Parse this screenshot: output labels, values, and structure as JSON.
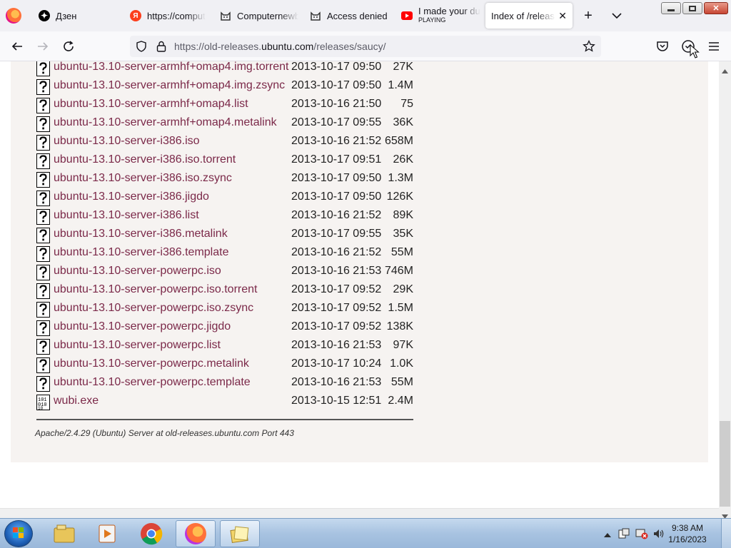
{
  "browser": {
    "tabs": [
      {
        "label": "Дзен",
        "icon": "dzen-icon"
      },
      {
        "label": "https://comput",
        "icon": "yandex-icon"
      },
      {
        "label": "Computernewb",
        "icon": "cat-icon"
      },
      {
        "label": "Access denied",
        "icon": "cat-icon"
      },
      {
        "label": "I made your du",
        "sublabel": "PLAYING",
        "icon": "youtube-icon"
      },
      {
        "label": "Index of /release",
        "icon": "none",
        "active": true
      }
    ],
    "url": {
      "prefix": "https://old-releases.",
      "host": "ubuntu.com",
      "path": "/releases/saucy/"
    }
  },
  "listing": {
    "rows": [
      {
        "name": "ubuntu-13.10-server-armhf+omap4.img.torrent",
        "date": "2013-10-17 09:50",
        "size": "27K",
        "icon": "unknown-file-icon"
      },
      {
        "name": "ubuntu-13.10-server-armhf+omap4.img.zsync",
        "date": "2013-10-17 09:50",
        "size": "1.4M",
        "icon": "unknown-file-icon"
      },
      {
        "name": "ubuntu-13.10-server-armhf+omap4.list",
        "date": "2013-10-16 21:50",
        "size": "75",
        "icon": "unknown-file-icon"
      },
      {
        "name": "ubuntu-13.10-server-armhf+omap4.metalink",
        "date": "2013-10-17 09:55",
        "size": "36K",
        "icon": "unknown-file-icon"
      },
      {
        "name": "ubuntu-13.10-server-i386.iso",
        "date": "2013-10-16 21:52",
        "size": "658M",
        "icon": "unknown-file-icon"
      },
      {
        "name": "ubuntu-13.10-server-i386.iso.torrent",
        "date": "2013-10-17 09:51",
        "size": "26K",
        "icon": "unknown-file-icon"
      },
      {
        "name": "ubuntu-13.10-server-i386.iso.zsync",
        "date": "2013-10-17 09:50",
        "size": "1.3M",
        "icon": "unknown-file-icon"
      },
      {
        "name": "ubuntu-13.10-server-i386.jigdo",
        "date": "2013-10-17 09:50",
        "size": "126K",
        "icon": "unknown-file-icon"
      },
      {
        "name": "ubuntu-13.10-server-i386.list",
        "date": "2013-10-16 21:52",
        "size": "89K",
        "icon": "unknown-file-icon"
      },
      {
        "name": "ubuntu-13.10-server-i386.metalink",
        "date": "2013-10-17 09:55",
        "size": "35K",
        "icon": "unknown-file-icon"
      },
      {
        "name": "ubuntu-13.10-server-i386.template",
        "date": "2013-10-16 21:52",
        "size": "55M",
        "icon": "unknown-file-icon"
      },
      {
        "name": "ubuntu-13.10-server-powerpc.iso",
        "date": "2013-10-16 21:53",
        "size": "746M",
        "icon": "unknown-file-icon"
      },
      {
        "name": "ubuntu-13.10-server-powerpc.iso.torrent",
        "date": "2013-10-17 09:52",
        "size": "29K",
        "icon": "unknown-file-icon"
      },
      {
        "name": "ubuntu-13.10-server-powerpc.iso.zsync",
        "date": "2013-10-17 09:52",
        "size": "1.5M",
        "icon": "unknown-file-icon"
      },
      {
        "name": "ubuntu-13.10-server-powerpc.jigdo",
        "date": "2013-10-17 09:52",
        "size": "138K",
        "icon": "unknown-file-icon"
      },
      {
        "name": "ubuntu-13.10-server-powerpc.list",
        "date": "2013-10-16 21:53",
        "size": "97K",
        "icon": "unknown-file-icon"
      },
      {
        "name": "ubuntu-13.10-server-powerpc.metalink",
        "date": "2013-10-17 10:24",
        "size": "1.0K",
        "icon": "unknown-file-icon"
      },
      {
        "name": "ubuntu-13.10-server-powerpc.template",
        "date": "2013-10-16 21:53",
        "size": "55M",
        "icon": "unknown-file-icon"
      },
      {
        "name": "wubi.exe",
        "date": "2013-10-15 12:51",
        "size": "2.4M",
        "icon": "binary-file-icon"
      }
    ],
    "footer": "Apache/2.4.29 (Ubuntu) Server at old-releases.ubuntu.com Port 443"
  },
  "taskbar": {
    "apps": [
      "file-explorer-icon",
      "media-player-icon",
      "chrome-icon",
      "firefox-icon",
      "folder-notes-icon"
    ],
    "clock": {
      "time": "9:38 AM",
      "date": "1/16/2023"
    }
  },
  "colors": {
    "link": "#7b2949",
    "panel": "#f6f3f1",
    "tab_strip": "#f0f0f4"
  }
}
